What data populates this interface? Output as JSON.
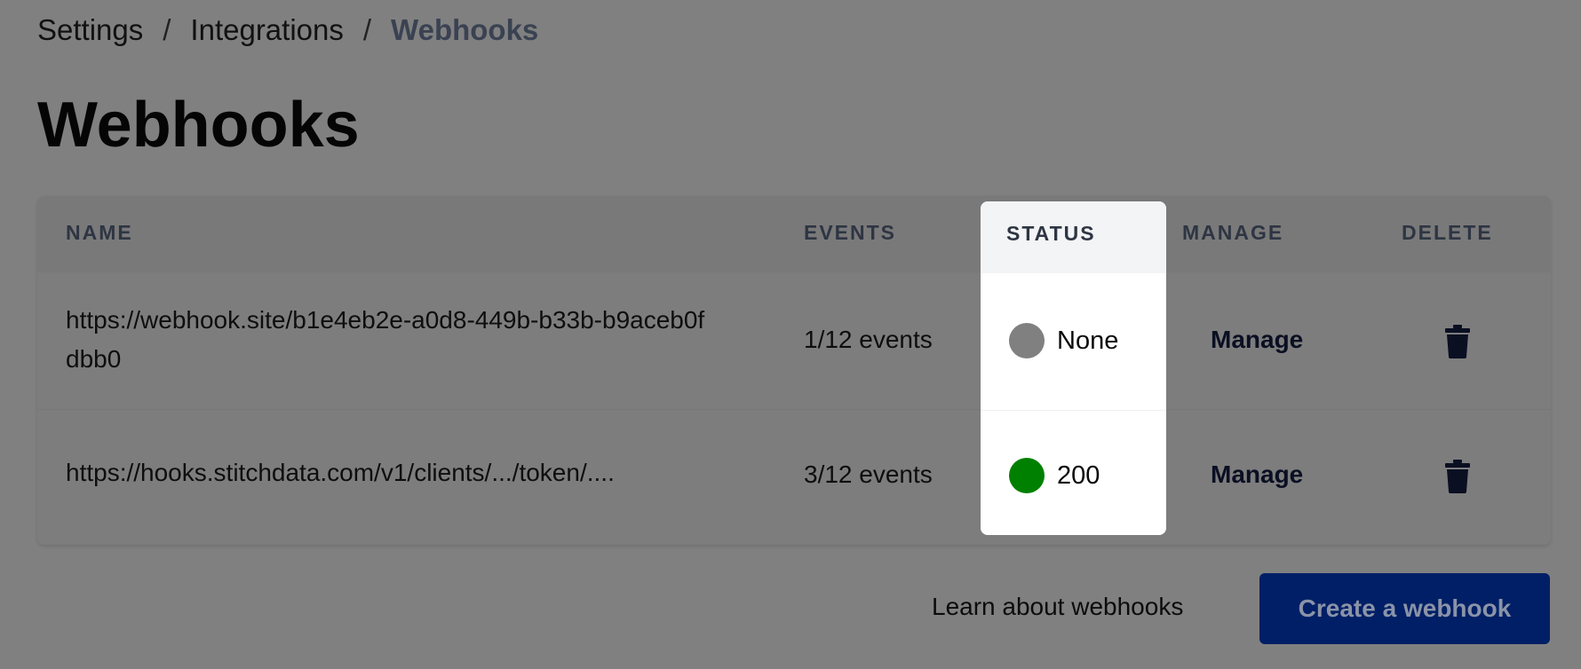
{
  "breadcrumb": {
    "items": [
      "Settings",
      "Integrations",
      "Webhooks"
    ],
    "separator": "/"
  },
  "page_title": "Webhooks",
  "table": {
    "columns": [
      "NAME",
      "EVENTS",
      "STATUS",
      "MANAGE",
      "DELETE"
    ],
    "rows": [
      {
        "name": "https://webhook.site/b1e4eb2e-a0d8-449b-b33b-b9aceb0fdbb0",
        "events": "1/12 events",
        "status": "None",
        "status_color": "#808080",
        "manage": "Manage",
        "delete_icon": "trash-icon"
      },
      {
        "name": "https://hooks.stitchdata.com/v1/clients/.../token/....",
        "events": "3/12 events",
        "status": "200",
        "status_color": "#008000",
        "manage": "Manage",
        "delete_icon": "trash-icon"
      }
    ]
  },
  "footer": {
    "learn_link": "Learn about webhooks",
    "create_button": "Create a webhook"
  },
  "colors": {
    "overlay": "#808080",
    "primary_button": "#001f66"
  }
}
